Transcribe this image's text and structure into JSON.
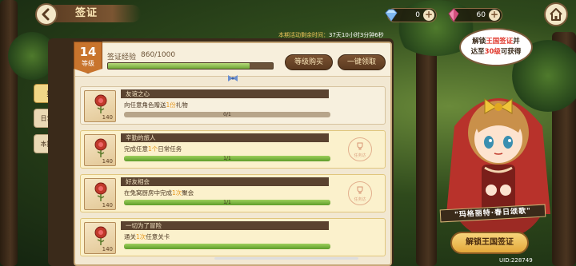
{
  "header": {
    "title": "签证",
    "timer_label": "本期活动剩余时间：",
    "timer_value": "37天10小时3分钟6秒"
  },
  "currency": {
    "diamonds": "0",
    "crystals": "60"
  },
  "level": {
    "number": "14",
    "label": "等级"
  },
  "exp": {
    "label": "签证经验",
    "value": "860/1000",
    "progress": 0.86
  },
  "buttons": {
    "buy_level": "等级购买",
    "claim_all": "一键领取"
  },
  "tabs": [
    {
      "label": "奖励",
      "active": true
    },
    {
      "label": "日常任务",
      "active": false
    },
    {
      "label": "本期任务",
      "active": false
    }
  ],
  "tasks": [
    {
      "title": "友谊之心",
      "desc_pre": "向任意角色赠送",
      "desc_hl": "1份",
      "desc_post": "礼物",
      "progress_text": "0/1",
      "progress": 0,
      "score": "140",
      "done": false,
      "stamp": ""
    },
    {
      "title": "辛勤的旅人",
      "desc_pre": "完成任意",
      "desc_hl": "1个",
      "desc_post": "日常任务",
      "progress_text": "1/1",
      "progress": 1,
      "score": "140",
      "done": true,
      "stamp": "任务达"
    },
    {
      "title": "好友相会",
      "desc_pre": "在兔窝厨房中完成",
      "desc_hl": "1次",
      "desc_post": "聚会",
      "progress_text": "1/1",
      "progress": 1,
      "score": "140",
      "done": true,
      "stamp": "任务达"
    },
    {
      "title": "一切为了冒险",
      "desc_pre": "通关",
      "desc_hl": "1次",
      "desc_post": "任意关卡",
      "progress_text": "",
      "progress": 1,
      "score": "140",
      "done": true,
      "stamp": ""
    }
  ],
  "promo": {
    "bubble_line1_a": "解锁",
    "bubble_line1_b": "王国签证",
    "bubble_line1_c": "并",
    "bubble_line2_a": "达至",
    "bubble_line2_b": "30级",
    "bubble_line2_c": "可获得",
    "banner": "\"玛格丽特·春日颂歌\"",
    "unlock_button": "解锁王国签证",
    "uid": "UID:228749"
  }
}
